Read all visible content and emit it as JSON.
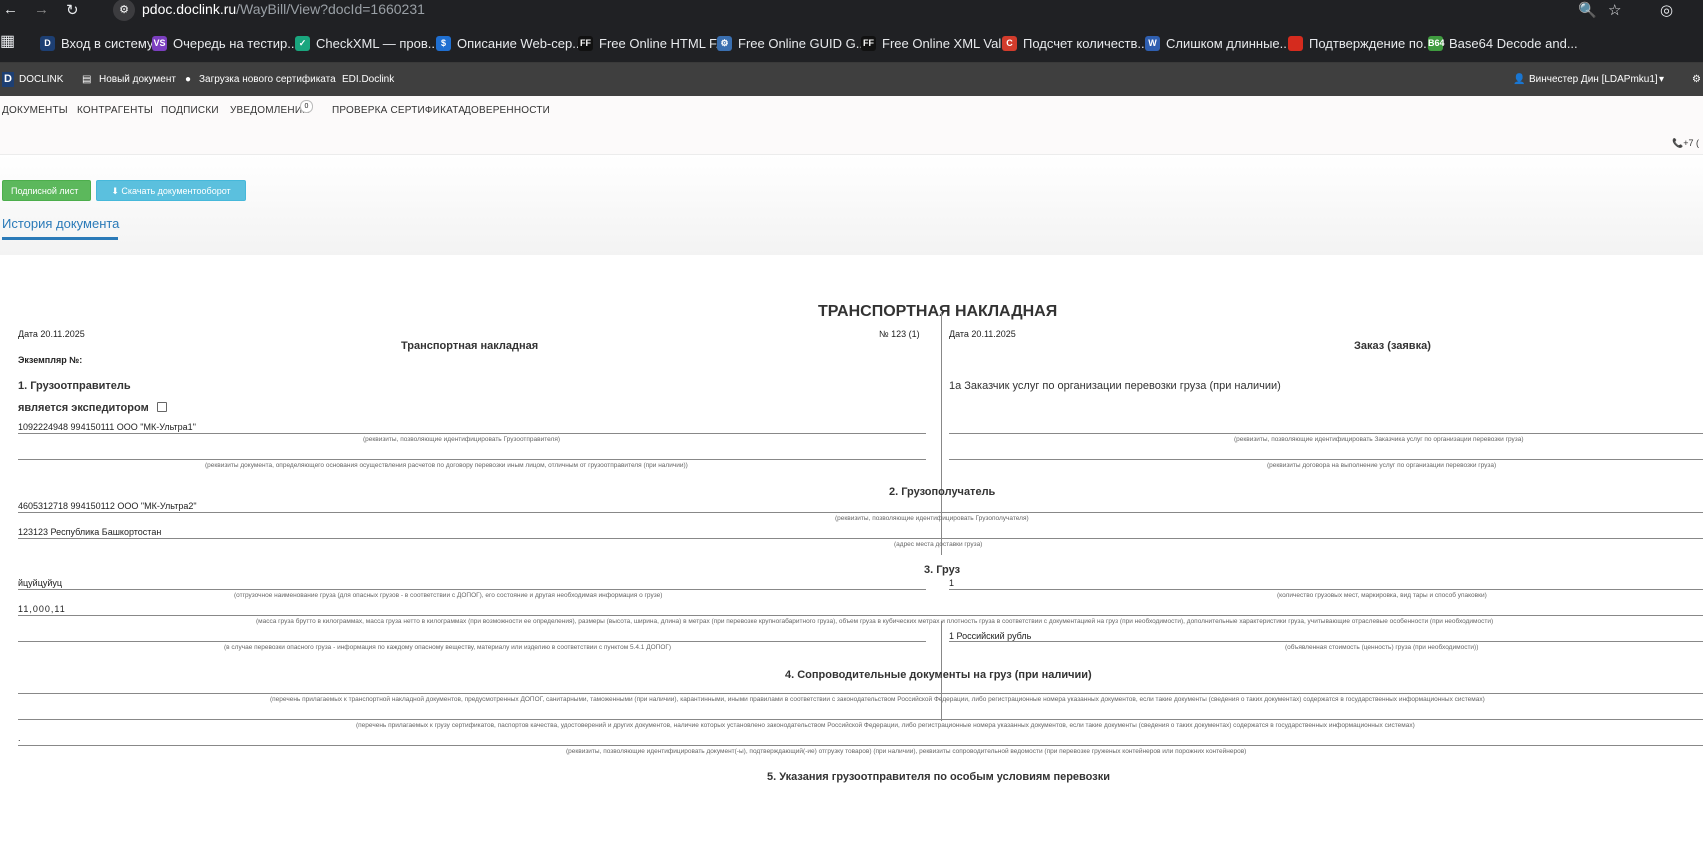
{
  "browser": {
    "url_host": "pdoc.doclink.ru",
    "url_path": "/WayBill/View?docId=1660231",
    "bookmarks": [
      {
        "label": "Вход в систему",
        "icon": "D",
        "color": "#1d3f73"
      },
      {
        "label": "Очередь на тестир...",
        "icon": "VS",
        "color": "#7b3fbf"
      },
      {
        "label": "CheckXML — пров...",
        "icon": "✓",
        "color": "#1aa67e"
      },
      {
        "label": "Описание Web-сер...",
        "icon": "$",
        "color": "#1f6fd1"
      },
      {
        "label": "Free Online HTML F...",
        "icon": "FF",
        "color": "#111111"
      },
      {
        "label": "Free Online GUID G...",
        "icon": "⚙",
        "color": "#3a6fb0"
      },
      {
        "label": "Free Online XML Val...",
        "icon": "FF",
        "color": "#111111"
      },
      {
        "label": "Подсчет количеств...",
        "icon": "C",
        "color": "#d23c2c"
      },
      {
        "label": "Слишком длинные...",
        "icon": "W",
        "color": "#2f5fb0"
      },
      {
        "label": "Подтверждение по...",
        "icon": "",
        "color": "#d52b1e"
      },
      {
        "label": "Base64 Decode and...",
        "icon": "B64",
        "color": "#3f9b3f"
      }
    ]
  },
  "app_header": {
    "logo": "DOCLINK",
    "new_doc": "Новый документ",
    "load_cert": "Загрузка нового сертификата",
    "edi": "EDI.Doclink",
    "user": "Винчестер Дин [LDAPmku1]"
  },
  "nav": {
    "tabs": [
      "ДОКУМЕНТЫ",
      "КОНТРАГЕНТЫ",
      "ПОДПИСКИ",
      "УВЕДОМЛЕНИЯ",
      "ПРОВЕРКА СЕРТИФИКАТА",
      "ДОВЕРЕННОСТИ"
    ],
    "notifications_count": "0",
    "phone": "+7 ("
  },
  "toolbar": {
    "sign_sheet": "Подписной лист",
    "download": "Скачать документооборот",
    "history_tab": "История документа"
  },
  "doc": {
    "title": "ТРАНСПОРТНАЯ НАКЛАДНАЯ",
    "left_heading": "Транспортная накладная",
    "right_heading": "Заказ (заявка)",
    "left_date": "Дата  20.11.2025",
    "number": "№   123 (1)",
    "right_date": "Дата 20.11.2025",
    "copy_no": "Экземпляр №:",
    "s1_title": "1. Грузоотправитель",
    "s1_forwarder": "является экспедитором",
    "s1a_title": "1а Заказчик услуг по организации перевозки груза (при наличии)",
    "shipper_value": "1092224948 994150111 ООО \"МК-Ультра1\"",
    "hint_shipper": "(реквизиты, позволяющие идентифицировать Грузоотправителя)",
    "hint_customer": "(реквизиты, позволяющие идентифицировать Заказчика услуг по организации перевозки груза)",
    "hint_payment": "(реквизиты документа, определяющего основания осуществления расчетов по договору перевозки иным лицом, отличным от грузоотправителя (при наличии))",
    "hint_contract": "(реквизиты договора на выполнение услуг по организации перевозки груза)",
    "s2_title": "2. Грузополучатель",
    "consignee_value": "4605312718 994150112 ООО \"МК-Ультра2\"",
    "hint_consignee": "(реквизиты, позволяющие идентифицировать Грузополучателя)",
    "address_value": "123123 Республика Башкортостан",
    "hint_address": "(адрес места доставки груза)",
    "s3_title": "3. Груз",
    "cargo_name": "йцуйцуйуц",
    "cargo_places": "1",
    "hint_cargo_name": "(отгрузочное наименование груза (для опасных грузов - в соответствии с ДОПОГ), его состояние и другая необходимая информация о грузе)",
    "hint_places": "(количество грузовых мест, маркировка, вид тары и способ упаковки)",
    "cargo_mass": "11,000,11",
    "hint_mass": "(масса груза брутто в килограммах, масса груза нетто в килограммах (при возможности ее определения), размеры (высота, ширина, длина) в метрах (при перевозке крупногабаритного груза), объем груза в кубических метрах и плотность груза в соответствии с документацией на груз (при необходимости), дополнительные характеристики груза, учитывающие отраслевые особенности (при необходимости)",
    "declared_value": "1 Российский рубль",
    "hint_dangerous": "(в случае перевозки опасного груза - информация по каждому опасному веществу, материалу или изделию в соответствии с пунктом 5.4.1 ДОПОГ)",
    "hint_declared": "(объявленная стоимость (ценность) груза (при необходимости))",
    "s4_title": "4. Сопроводительные документы на груз (при наличии)",
    "hint_docs1": "(перечень прилагаемых к транспортной накладной документов, предусмотренных ДОПОГ, санитарными, таможенными (при наличии), карантинными, иными правилами в соответствии с законодательством Российской Федерации, либо регистрационные номера указанных документов, если такие документы (сведения о таких документах) содержатся в государственных информационных системах)",
    "hint_docs2": "(перечень прилагаемых к грузу сертификатов, паспортов качества, удостоверений и других документов, наличие которых установлено законодательством Российской Федерации, либо регистрационные номера указанных документов, если такие документы (сведения о таких документах) содержатся в государственных информационных системах)",
    "docs3_value": ".",
    "hint_docs3": "(реквизиты, позволяющие идентифицировать документ(-ы), подтверждающий(-ие) отгрузку товаров) (при наличии), реквизиты сопроводительной ведомости (при перевозке груженых контейнеров или порожних контейнеров)",
    "s5_title": "5. Указания грузоотправителя по особым условиям перевозки"
  }
}
